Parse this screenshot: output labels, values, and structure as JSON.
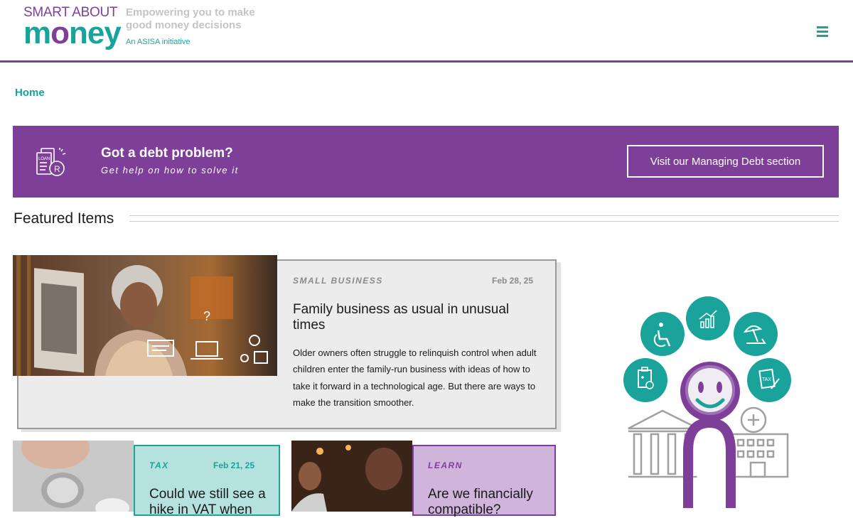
{
  "header": {
    "logo_top": "SMART ABOUT",
    "logo_word_m": "m",
    "logo_word_o": "o",
    "logo_word_rest": "ney",
    "tagline": "Empowering you to make good money decisions",
    "initiative": "An ASISA initiative"
  },
  "breadcrumb": {
    "home": "Home"
  },
  "banner": {
    "title": "Got a debt problem?",
    "subtitle": "Get help on how to solve it",
    "button": "Visit our Managing Debt section",
    "icon_text": "LOAN"
  },
  "featured": {
    "heading": "Featured Items",
    "main_card": {
      "category": "SMALL BUSINESS",
      "date": "Feb 28, 25",
      "title": "Family business as usual in unusual times",
      "body": "Older owners often struggle to relinquish control when adult children enter the family-run business with ideas of how to take it forward in a technological age. But there are ways to make the transition smoother."
    },
    "cards": [
      {
        "category": "TAX",
        "date": "Feb 21, 25",
        "title": "Could we still see a hike in VAT when"
      },
      {
        "category": "LEARN",
        "title": "Are we financially compatible?"
      }
    ]
  },
  "illustration": {
    "tax_label": "TAX"
  },
  "colors": {
    "purple": "#7e3f98",
    "teal": "#1aa39b",
    "lilac": "#d0b4dc",
    "mint": "#b5e2df"
  }
}
